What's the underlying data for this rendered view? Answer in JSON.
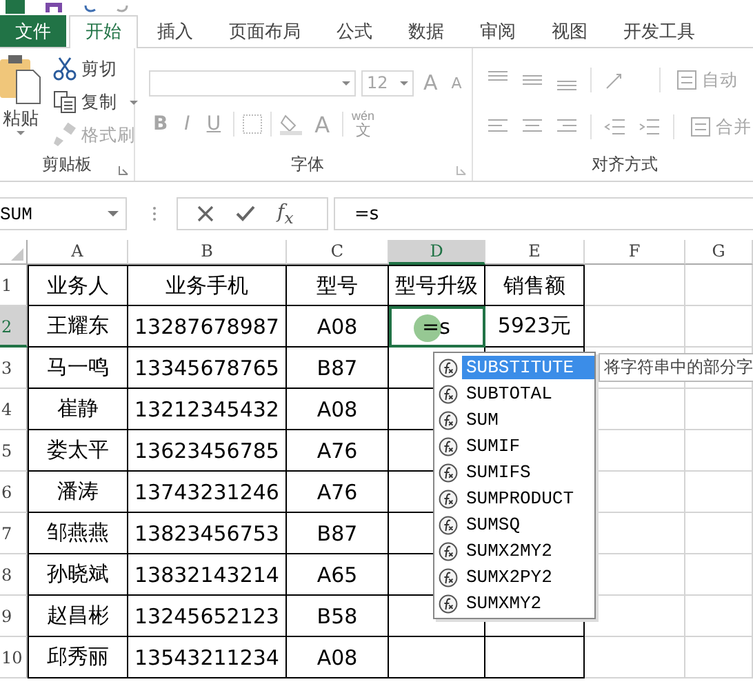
{
  "tabs": [
    {
      "label": "文件",
      "kind": "file",
      "selected": false
    },
    {
      "label": "开始",
      "kind": "tab",
      "selected": true
    },
    {
      "label": "插入",
      "kind": "tab",
      "selected": false
    },
    {
      "label": "页面布局",
      "kind": "tab",
      "selected": false
    },
    {
      "label": "公式",
      "kind": "tab",
      "selected": false
    },
    {
      "label": "数据",
      "kind": "tab",
      "selected": false
    },
    {
      "label": "审阅",
      "kind": "tab",
      "selected": false
    },
    {
      "label": "视图",
      "kind": "tab",
      "selected": false
    },
    {
      "label": "开发工具",
      "kind": "tab",
      "selected": false
    }
  ],
  "ribbon": {
    "clipboard": {
      "label": "剪贴板",
      "paste": "粘贴",
      "items": [
        {
          "label": "剪切",
          "kind": "cut",
          "disabled": false
        },
        {
          "label": "复制",
          "kind": "copy",
          "disabled": false
        },
        {
          "label": "格式刷",
          "kind": "brush",
          "disabled": true
        }
      ]
    },
    "font": {
      "label": "字体",
      "disabled": true,
      "size": "12",
      "grow": "A",
      "shrink": "A",
      "styles": [
        "B",
        "I",
        "U"
      ],
      "color_letter": "A",
      "phonetic_top": "wén",
      "phonetic_bottom": "文"
    },
    "alignment": {
      "label": "对齐方式",
      "disabled": true,
      "wrap": "自动",
      "merge": "合并"
    }
  },
  "formula_bar": {
    "name_box": "SUM",
    "fx": "f$_{x}$",
    "formula": "=s"
  },
  "sheet": {
    "columns": [
      {
        "label": "A",
        "selected": false
      },
      {
        "label": "B",
        "selected": false
      },
      {
        "label": "C",
        "selected": false
      },
      {
        "label": "D",
        "selected": true
      },
      {
        "label": "E",
        "selected": false
      },
      {
        "label": "F",
        "selected": false
      },
      {
        "label": "G",
        "selected": false
      }
    ],
    "rows": [
      {
        "number": "1",
        "selected": false,
        "cells": [
          "业务人",
          "业务手机",
          "型号",
          "型号升级",
          "销售额"
        ]
      },
      {
        "number": "2",
        "selected": true,
        "cells": [
          "王耀东",
          "13287678987",
          "A08",
          "=s",
          "5923元"
        ]
      },
      {
        "number": "3",
        "selected": false,
        "cells": [
          "马一鸣",
          "13345678765",
          "B87",
          "",
          ""
        ]
      },
      {
        "number": "4",
        "selected": false,
        "cells": [
          "崔静",
          "13212345432",
          "A08",
          "",
          ""
        ]
      },
      {
        "number": "5",
        "selected": false,
        "cells": [
          "娄太平",
          "13623456785",
          "A76",
          "",
          ""
        ]
      },
      {
        "number": "6",
        "selected": false,
        "cells": [
          "潘涛",
          "13743231246",
          "A76",
          "",
          ""
        ]
      },
      {
        "number": "7",
        "selected": false,
        "cells": [
          "邹燕燕",
          "13823456753",
          "B87",
          "",
          ""
        ]
      },
      {
        "number": "8",
        "selected": false,
        "cells": [
          "孙晓斌",
          "13832143214",
          "A65",
          "",
          ""
        ]
      },
      {
        "number": "9",
        "selected": false,
        "cells": [
          "赵昌彬",
          "13245652123",
          "B58",
          "",
          ""
        ]
      },
      {
        "number": "10",
        "selected": false,
        "cells": [
          "邱秀丽",
          "13543211234",
          "A08",
          "",
          ""
        ]
      }
    ]
  },
  "autocomplete": {
    "items": [
      {
        "label": "SUBSTITUTE",
        "selected": true
      },
      {
        "label": "SUBTOTAL",
        "selected": false
      },
      {
        "label": "SUM",
        "selected": false
      },
      {
        "label": "SUMIF",
        "selected": false
      },
      {
        "label": "SUMIFS",
        "selected": false
      },
      {
        "label": "SUMPRODUCT",
        "selected": false
      },
      {
        "label": "SUMSQ",
        "selected": false
      },
      {
        "label": "SUMX2MY2",
        "selected": false
      },
      {
        "label": "SUMX2PY2",
        "selected": false
      },
      {
        "label": "SUMXMY2",
        "selected": false
      }
    ],
    "tooltip": "将字符串中的部分字"
  }
}
